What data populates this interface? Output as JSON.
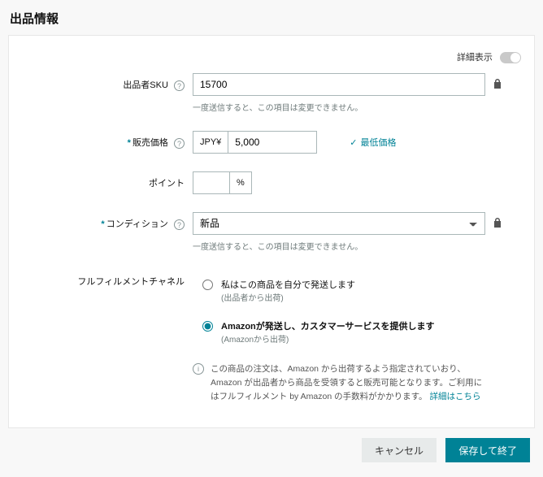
{
  "page_title": "出品情報",
  "detail_toggle_label": "詳細表示",
  "sku": {
    "label": "出品者SKU",
    "value": "15700",
    "hint": "一度送信すると、この項目は変更できません。"
  },
  "price": {
    "label": "販売価格",
    "currency": "JPY¥",
    "value": "5,000",
    "min_price_label": "最低価格"
  },
  "points": {
    "label": "ポイント",
    "value": "",
    "unit": "%"
  },
  "condition": {
    "label": "コンディション",
    "value": "新品",
    "hint": "一度送信すると、この項目は変更できません。"
  },
  "fulfillment": {
    "label": "フルフィルメントチャネル",
    "options": [
      {
        "title": "私はこの商品を自分で発送します",
        "sub": "(出品者から出荷)"
      },
      {
        "title": "Amazonが発送し、カスタマーサービスを提供します",
        "sub": "(Amazonから出荷)"
      }
    ],
    "selected": 1,
    "info_text": "この商品の注文は、Amazon から出荷するよう指定されていおり、Amazon が出品者から商品を受領すると販売可能となります。ご利用にはフルフィルメント by Amazon の手数料がかかります。",
    "info_link": "詳細はこちら"
  },
  "buttons": {
    "cancel": "キャンセル",
    "save": "保存して終了"
  }
}
